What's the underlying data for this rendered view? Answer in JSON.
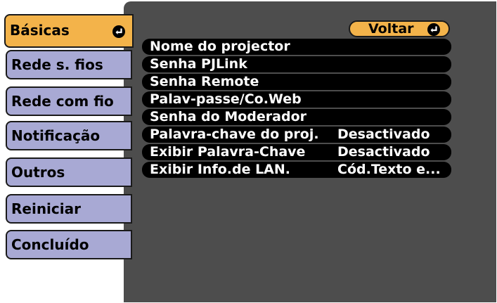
{
  "sidebar": {
    "items": [
      {
        "label": "Básicas"
      },
      {
        "label": "Rede s. fios"
      },
      {
        "label": "Rede com fio"
      },
      {
        "label": "Notificação"
      },
      {
        "label": "Outros"
      },
      {
        "label": "Reiniciar"
      },
      {
        "label": "Concluído"
      }
    ],
    "selected_index": 0
  },
  "main": {
    "back_label": "Voltar",
    "items": [
      {
        "label": "Nome do projector",
        "value": ""
      },
      {
        "label": "Senha PJLink",
        "value": ""
      },
      {
        "label": "Senha Remote",
        "value": ""
      },
      {
        "label": "Palav-passe/Co.Web",
        "value": ""
      },
      {
        "label": "Senha do Moderador",
        "value": ""
      },
      {
        "label": "Palavra-chave do proj.",
        "value": "Desactivado"
      },
      {
        "label": "Exibir Palavra-Chave",
        "value": "Desactivado"
      },
      {
        "label": "Exibir Info.de LAN.",
        "value": "Cód.Texto e..."
      }
    ]
  },
  "icons": {
    "enter": "enter-icon"
  },
  "colors": {
    "tab": "#a8a9d4",
    "selected": "#f3b34a",
    "panel": "#4d4d4d",
    "item": "#000000"
  }
}
